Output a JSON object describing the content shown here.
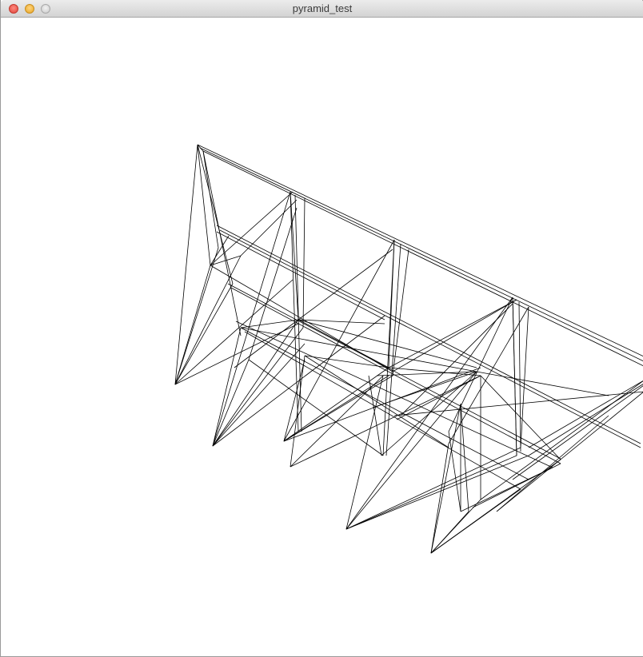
{
  "window": {
    "title": "pyramid_test"
  },
  "titlebar": {
    "buttons": [
      {
        "name": "close",
        "color": "#e0443a"
      },
      {
        "name": "minimize",
        "color": "#e8a523"
      },
      {
        "name": "zoom",
        "color": "#c9c9c9"
      }
    ]
  },
  "canvas": {
    "background": "#ffffff",
    "stroke": "#000000"
  }
}
